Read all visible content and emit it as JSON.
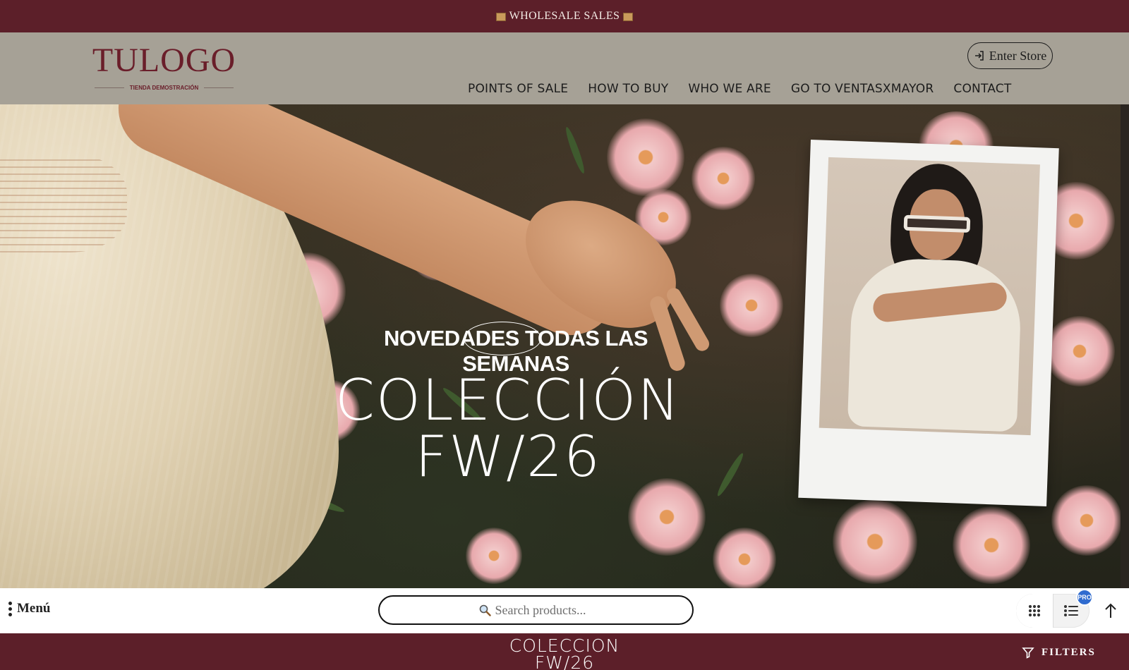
{
  "promo_bar": {
    "text": "WHOLESALE SALES",
    "icon": "package-icon"
  },
  "header": {
    "logo_text": "TULOGO",
    "logo_subtitle": "TIENDA DEMOSTRACIÓN",
    "enter_store_label": "Enter Store",
    "enter_store_icon": "sign-in-icon",
    "nav": [
      {
        "label": "POINTS OF SALE"
      },
      {
        "label": "HOW TO BUY"
      },
      {
        "label": "WHO WE ARE"
      },
      {
        "label": "GO TO VENTASXMAYOR"
      },
      {
        "label": "CONTACT"
      }
    ]
  },
  "hero": {
    "tagline_prefix": "NOVEDADES",
    "tagline_highlight": "TODAS",
    "tagline_suffix": "LAS SEMANAS",
    "title_line1": "COLECCIÓN",
    "title_line2": "FW/26"
  },
  "toolbar": {
    "menu_label": "Menú",
    "search_placeholder": "Search products...",
    "pro_badge": "PRO",
    "icons": [
      "grid-view-icon",
      "list-view-icon",
      "arrow-up-icon"
    ]
  },
  "bottom_strip": {
    "title_line1": "COLECCION",
    "title_line2": "FW/26",
    "filters_label": "FILTERS"
  },
  "colors": {
    "brand_maroon": "#5c1f29",
    "header_bg": "#a6a196",
    "logo_color": "#6a1e2a",
    "pro_blue": "#2f6bcf"
  }
}
